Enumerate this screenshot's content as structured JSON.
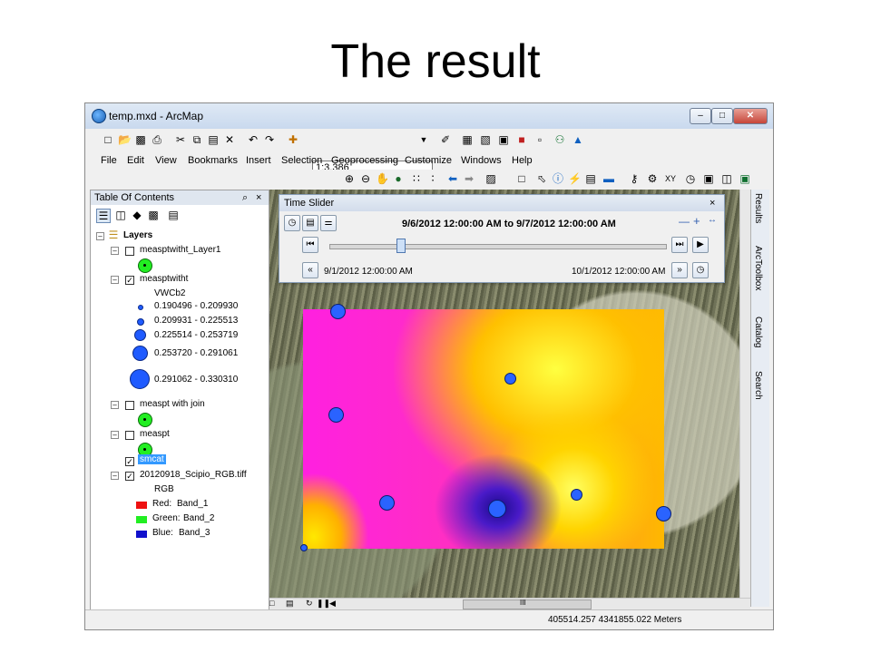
{
  "slide": {
    "title": "The result"
  },
  "window": {
    "title": "temp.mxd - ArcMap",
    "minimize": "–",
    "maximize": "□",
    "close": "✕"
  },
  "toolbar": {
    "scale": "1:3,386"
  },
  "menu": {
    "items": [
      "File",
      "Edit",
      "View",
      "Bookmarks",
      "Insert",
      "Selection",
      "Geoprocessing",
      "Customize",
      "Windows",
      "Help"
    ]
  },
  "toc": {
    "title": "Table Of Contents",
    "pin": "⌕",
    "close": "×",
    "layers_root": "Layers",
    "layer1": "measptwitht_Layer1",
    "layer2": "measptwitht",
    "layer2_field": "VWCb2",
    "legend": [
      "0.190496 - 0.209930",
      "0.209931 - 0.225513",
      "0.225514 - 0.253719",
      "0.253720 - 0.291061",
      "0.291062 - 0.330310"
    ],
    "layer3": "measpt with join",
    "layer4": "measpt",
    "layer5": "smcat",
    "layer6": "20120918_Scipio_RGB.tiff",
    "layer6_type": "RGB",
    "bands": [
      {
        "label": "Red:",
        "band": "Band_1",
        "color": "#ee1111"
      },
      {
        "label": "Green:",
        "band": "Band_2",
        "color": "#22ee22"
      },
      {
        "label": "Blue:",
        "band": "Band_3",
        "color": "#1111cc"
      }
    ]
  },
  "time_slider": {
    "title": "Time Slider",
    "close": "×",
    "current_range": "9/6/2012 12:00:00 AM to 9/7/2012 12:00:00 AM",
    "start": "9/1/2012 12:00:00 AM",
    "end": "10/1/2012 12:00:00 AM",
    "position": 0.2
  },
  "dock": {
    "tabs": [
      "Results",
      "ArcToolbox",
      "Catalog",
      "Search"
    ]
  },
  "status": {
    "coords": "405514.257  4341855.022 Meters"
  },
  "hscroll": {
    "grip": "III"
  }
}
